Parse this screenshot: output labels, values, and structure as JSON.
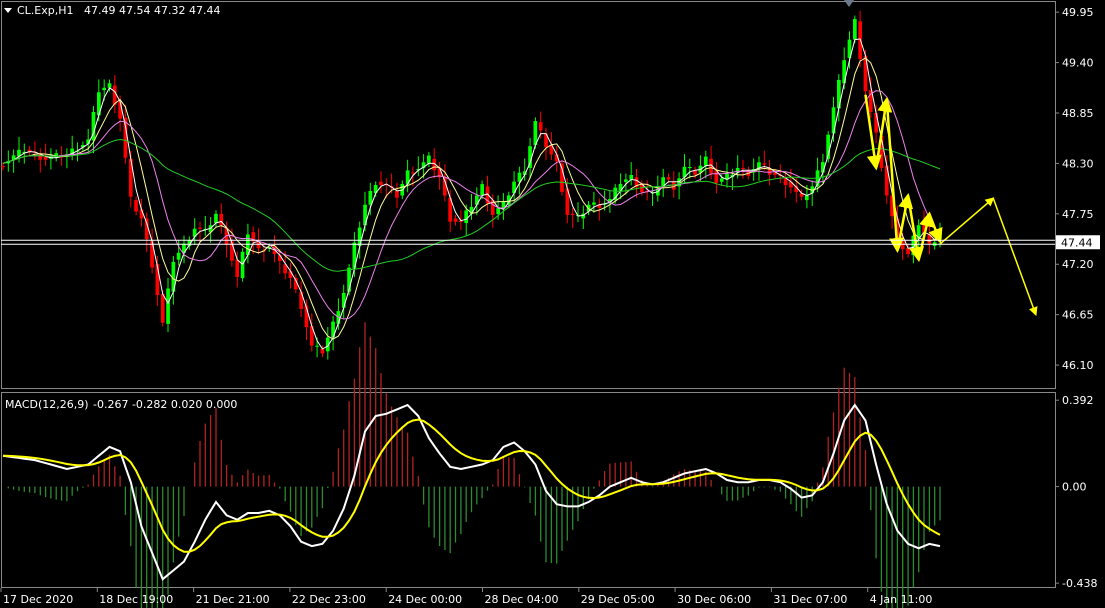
{
  "header": {
    "symbol": "CL.Exp,H1",
    "ohlc": "47.49 47.54 47.32 47.44"
  },
  "macd_header": {
    "label": "MACD(12,26,9)",
    "values": "-0.267 -0.282 0.020 0.000"
  },
  "colors": {
    "background": "#000000",
    "bull_candle": "#00ff00",
    "bear_candle": "#ff0000",
    "ma_fast": "#ffffff",
    "ma_mid": "#ffff99",
    "ma_slow": "#ee82ee",
    "ma_long": "#22cc22",
    "macd_line": "#ffffff",
    "signal_line": "#ffff00",
    "hist_pos": "#b22222",
    "hist_neg": "#2e8b2e",
    "forecast": "#ffff00"
  },
  "chart_data": [
    {
      "type": "candlestick",
      "title": "CL.Exp,H1",
      "ylim": [
        45.85,
        50.05
      ],
      "yticks": [
        "49.95",
        "49.40",
        "48.85",
        "48.30",
        "47.75",
        "47.20",
        "46.65",
        "46.10"
      ],
      "current_price": "47.44",
      "xticks": [
        "17 Dec 2020",
        "18 Dec 19:00",
        "21 Dec 21:00",
        "22 Dec 23:00",
        "24 Dec 00:00",
        "28 Dec 04:00",
        "29 Dec 05:00",
        "30 Dec 06:00",
        "31 Dec 07:00",
        "4 Jan 11:00"
      ],
      "trend_path": [
        [
          0,
          48.3
        ],
        [
          4,
          48.45
        ],
        [
          8,
          48.35
        ],
        [
          12,
          48.4
        ],
        [
          16,
          48.55
        ],
        [
          18,
          49.1
        ],
        [
          20,
          49.15
        ],
        [
          22,
          48.8
        ],
        [
          24,
          47.9
        ],
        [
          26,
          47.7
        ],
        [
          28,
          47.2
        ],
        [
          30,
          46.55
        ],
        [
          32,
          47.25
        ],
        [
          34,
          47.4
        ],
        [
          36,
          47.6
        ],
        [
          38,
          47.55
        ],
        [
          40,
          47.75
        ],
        [
          42,
          47.45
        ],
        [
          44,
          47.05
        ],
        [
          46,
          47.55
        ],
        [
          48,
          47.35
        ],
        [
          50,
          47.4
        ],
        [
          52,
          47.2
        ],
        [
          54,
          47.05
        ],
        [
          56,
          46.75
        ],
        [
          58,
          46.3
        ],
        [
          60,
          46.25
        ],
        [
          62,
          46.55
        ],
        [
          64,
          46.9
        ],
        [
          66,
          47.4
        ],
        [
          68,
          47.85
        ],
        [
          70,
          48.1
        ],
        [
          72,
          48.05
        ],
        [
          74,
          47.95
        ],
        [
          76,
          48.2
        ],
        [
          78,
          48.25
        ],
        [
          80,
          48.35
        ],
        [
          82,
          48.15
        ],
        [
          84,
          47.7
        ],
        [
          86,
          47.65
        ],
        [
          88,
          47.85
        ],
        [
          90,
          48.05
        ],
        [
          92,
          47.75
        ],
        [
          94,
          47.85
        ],
        [
          96,
          48.1
        ],
        [
          98,
          48.25
        ],
        [
          100,
          48.75
        ],
        [
          102,
          48.5
        ],
        [
          104,
          48.3
        ],
        [
          106,
          47.75
        ],
        [
          108,
          47.7
        ],
        [
          110,
          47.85
        ],
        [
          112,
          47.85
        ],
        [
          114,
          47.9
        ],
        [
          116,
          48.1
        ],
        [
          118,
          48.15
        ],
        [
          120,
          48.0
        ],
        [
          122,
          47.95
        ],
        [
          124,
          48.15
        ],
        [
          126,
          48.05
        ],
        [
          128,
          48.25
        ],
        [
          130,
          48.2
        ],
        [
          132,
          48.35
        ],
        [
          134,
          48.1
        ],
        [
          136,
          48.15
        ],
        [
          138,
          48.25
        ],
        [
          140,
          48.2
        ],
        [
          142,
          48.3
        ],
        [
          144,
          48.2
        ],
        [
          146,
          48.15
        ],
        [
          148,
          48.05
        ],
        [
          150,
          47.9
        ],
        [
          152,
          48.05
        ],
        [
          154,
          48.35
        ],
        [
          156,
          48.9
        ],
        [
          158,
          49.45
        ],
        [
          160,
          49.85
        ],
        [
          162,
          49.1
        ],
        [
          164,
          48.6
        ],
        [
          166,
          47.95
        ],
        [
          168,
          47.45
        ],
        [
          170,
          47.3
        ],
        [
          172,
          47.65
        ],
        [
          174,
          47.4
        ],
        [
          176,
          47.55
        ]
      ],
      "moving_averages": [
        {
          "role": "fast",
          "smoothing": 3
        },
        {
          "role": "mid",
          "smoothing": 6
        },
        {
          "role": "slow",
          "smoothing": 11
        },
        {
          "role": "long",
          "smoothing": 34
        }
      ],
      "forecast": {
        "zigzag": [
          [
            162,
            49.05
          ],
          [
            164,
            48.25
          ],
          [
            166,
            49.0
          ],
          [
            168,
            47.35
          ],
          [
            170,
            47.95
          ],
          [
            172,
            47.25
          ],
          [
            174,
            47.75
          ],
          [
            176,
            47.45
          ]
        ],
        "projection": [
          [
            176,
            47.42
          ],
          [
            186,
            47.92
          ],
          [
            194,
            46.65
          ]
        ]
      }
    },
    {
      "type": "macd",
      "title": "MACD(12,26,9)",
      "ylim": [
        -0.46,
        0.42
      ],
      "yticks": [
        "0.392",
        "0.00",
        "-0.438"
      ],
      "macd": [
        [
          0,
          0.14
        ],
        [
          6,
          0.12
        ],
        [
          12,
          0.08
        ],
        [
          16,
          0.1
        ],
        [
          20,
          0.18
        ],
        [
          22,
          0.16
        ],
        [
          24,
          0.02
        ],
        [
          26,
          -0.18
        ],
        [
          28,
          -0.3
        ],
        [
          30,
          -0.42
        ],
        [
          32,
          -0.38
        ],
        [
          34,
          -0.34
        ],
        [
          36,
          -0.25
        ],
        [
          38,
          -0.15
        ],
        [
          40,
          -0.07
        ],
        [
          42,
          -0.13
        ],
        [
          44,
          -0.15
        ],
        [
          46,
          -0.12
        ],
        [
          48,
          -0.12
        ],
        [
          50,
          -0.11
        ],
        [
          52,
          -0.13
        ],
        [
          54,
          -0.18
        ],
        [
          56,
          -0.25
        ],
        [
          58,
          -0.27
        ],
        [
          60,
          -0.26
        ],
        [
          62,
          -0.2
        ],
        [
          64,
          -0.1
        ],
        [
          66,
          0.05
        ],
        [
          68,
          0.25
        ],
        [
          70,
          0.32
        ],
        [
          72,
          0.33
        ],
        [
          74,
          0.35
        ],
        [
          76,
          0.37
        ],
        [
          78,
          0.32
        ],
        [
          80,
          0.22
        ],
        [
          82,
          0.15
        ],
        [
          84,
          0.09
        ],
        [
          86,
          0.08
        ],
        [
          88,
          0.09
        ],
        [
          90,
          0.1
        ],
        [
          92,
          0.12
        ],
        [
          94,
          0.18
        ],
        [
          96,
          0.2
        ],
        [
          98,
          0.16
        ],
        [
          100,
          0.1
        ],
        [
          102,
          -0.02
        ],
        [
          104,
          -0.08
        ],
        [
          106,
          -0.09
        ],
        [
          108,
          -0.09
        ],
        [
          110,
          -0.07
        ],
        [
          112,
          -0.04
        ],
        [
          114,
          0.0
        ],
        [
          116,
          0.02
        ],
        [
          118,
          0.04
        ],
        [
          120,
          0.02
        ],
        [
          122,
          0.01
        ],
        [
          124,
          0.02
        ],
        [
          126,
          0.04
        ],
        [
          128,
          0.06
        ],
        [
          130,
          0.07
        ],
        [
          132,
          0.08
        ],
        [
          134,
          0.06
        ],
        [
          136,
          0.03
        ],
        [
          138,
          0.02
        ],
        [
          140,
          0.02
        ],
        [
          142,
          0.03
        ],
        [
          144,
          0.03
        ],
        [
          146,
          0.02
        ],
        [
          148,
          -0.01
        ],
        [
          150,
          -0.05
        ],
        [
          152,
          -0.04
        ],
        [
          154,
          0.02
        ],
        [
          156,
          0.15
        ],
        [
          158,
          0.3
        ],
        [
          160,
          0.37
        ],
        [
          162,
          0.3
        ],
        [
          164,
          0.1
        ],
        [
          166,
          -0.08
        ],
        [
          168,
          -0.2
        ],
        [
          170,
          -0.26
        ],
        [
          172,
          -0.28
        ],
        [
          174,
          -0.26
        ],
        [
          176,
          -0.27
        ]
      ],
      "signal_smoothing": 9,
      "hist_scale": 3.0
    }
  ]
}
